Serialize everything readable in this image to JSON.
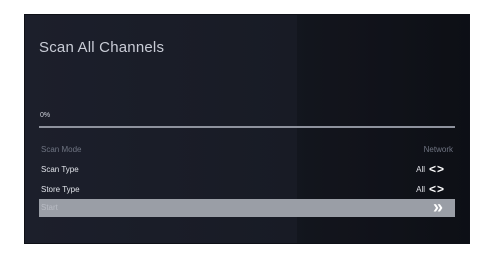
{
  "screen": {
    "title": "Scan All Channels"
  },
  "progress": {
    "label": "0%",
    "value": 0
  },
  "rows": {
    "scan_mode": {
      "label": "Scan Mode",
      "value": "Network"
    },
    "scan_type": {
      "label": "Scan Type",
      "value": "All",
      "arrows": "<>"
    },
    "store_type": {
      "label": "Store Type",
      "value": "All",
      "arrows": "<>"
    },
    "start": {
      "label": "Start",
      "chevron": "»"
    }
  },
  "colors": {
    "background": "#1c1f2b",
    "highlight": "#9a9ea6",
    "text": "#e2e4ea",
    "disabled_text": "#6f7482"
  }
}
